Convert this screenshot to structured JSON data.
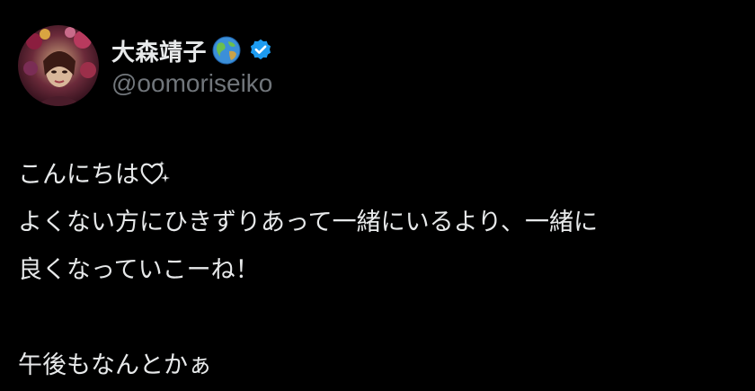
{
  "user": {
    "display_name": "大森靖子",
    "handle": "@oomoriseiko",
    "name_emoji": "globe-icon",
    "verified": true,
    "verified_color": "#1d9bf0"
  },
  "tweet": {
    "line1": "こんにちは",
    "line1_emoji": "heart-sparkle-icon",
    "line2": "よくない方にひきずりあって一緒にいるより、一緒に",
    "line3": "良くなっていこーね！",
    "line4": "午後もなんとかぁ"
  },
  "colors": {
    "background": "#000000",
    "text": "#e7e9ea",
    "secondary_text": "#71767b"
  }
}
